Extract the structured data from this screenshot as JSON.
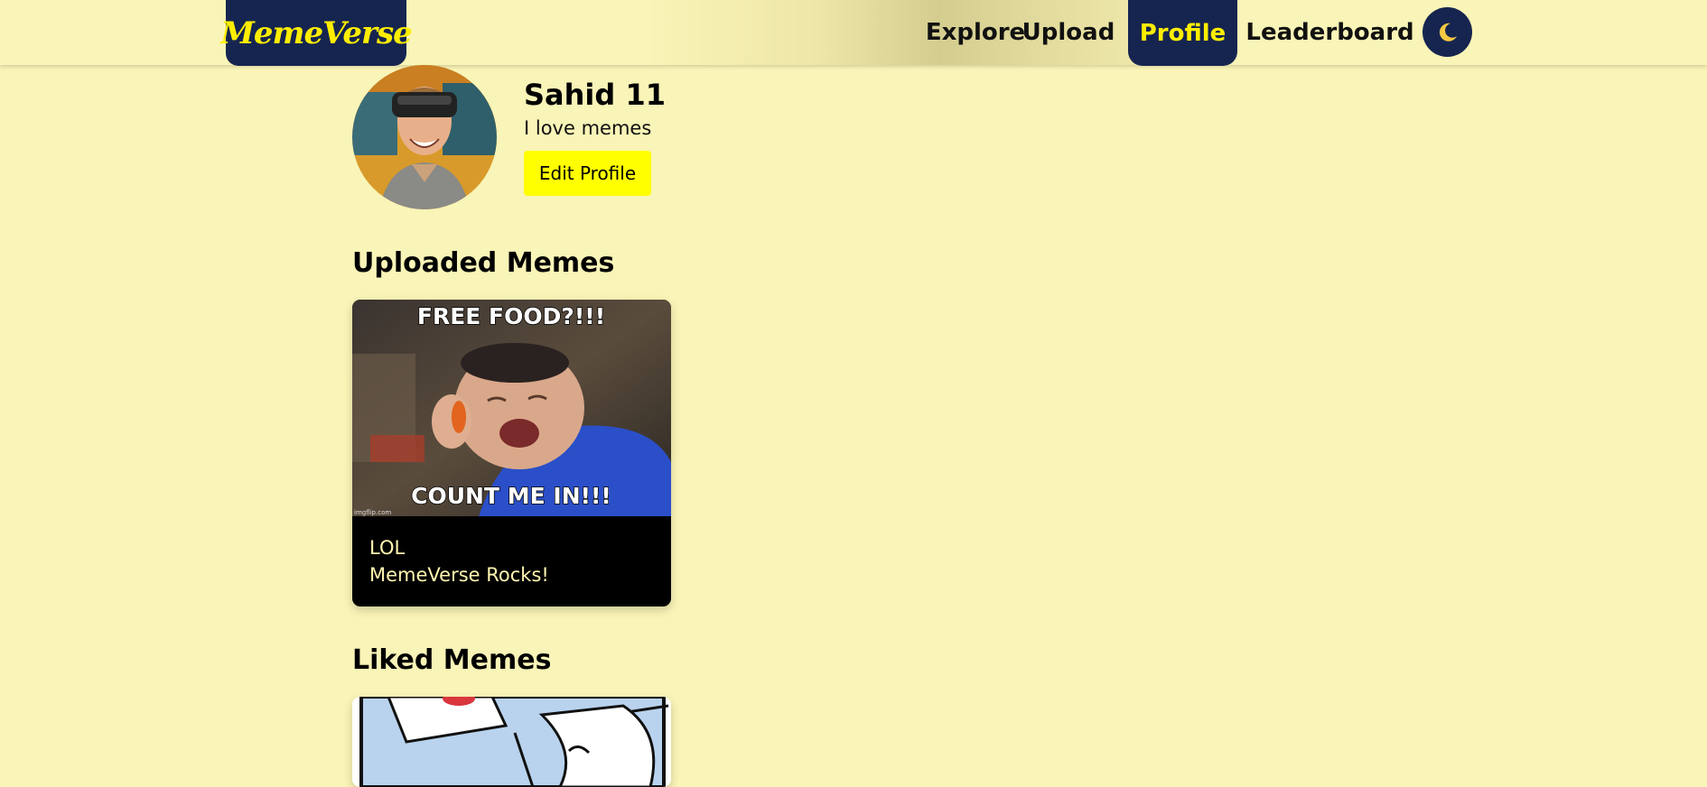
{
  "app": {
    "logo_text": "MemeVerse"
  },
  "nav": {
    "explore": "Explore",
    "upload": "Upload",
    "profile": "Profile",
    "leaderboard": "Leaderboard",
    "theme_icon": "moon-icon"
  },
  "profile": {
    "name": "Sahid 11",
    "bio": "I love memes",
    "edit_label": "Edit Profile",
    "avatar_icon": "user-avatar"
  },
  "sections": {
    "uploaded_title": "Uploaded Memes",
    "liked_title": "Liked Memes"
  },
  "uploaded_memes": [
    {
      "top_text": "FREE FOOD?!!!",
      "bottom_text": "COUNT ME IN!!!",
      "watermark": "imgflip.com",
      "caption_line1": "LOL",
      "caption_line2": "MemeVerse Rocks!"
    }
  ],
  "colors": {
    "background": "#f9f4b7",
    "navy": "#162550",
    "accent_yellow": "#ffee00",
    "button_yellow": "#ffff00"
  }
}
